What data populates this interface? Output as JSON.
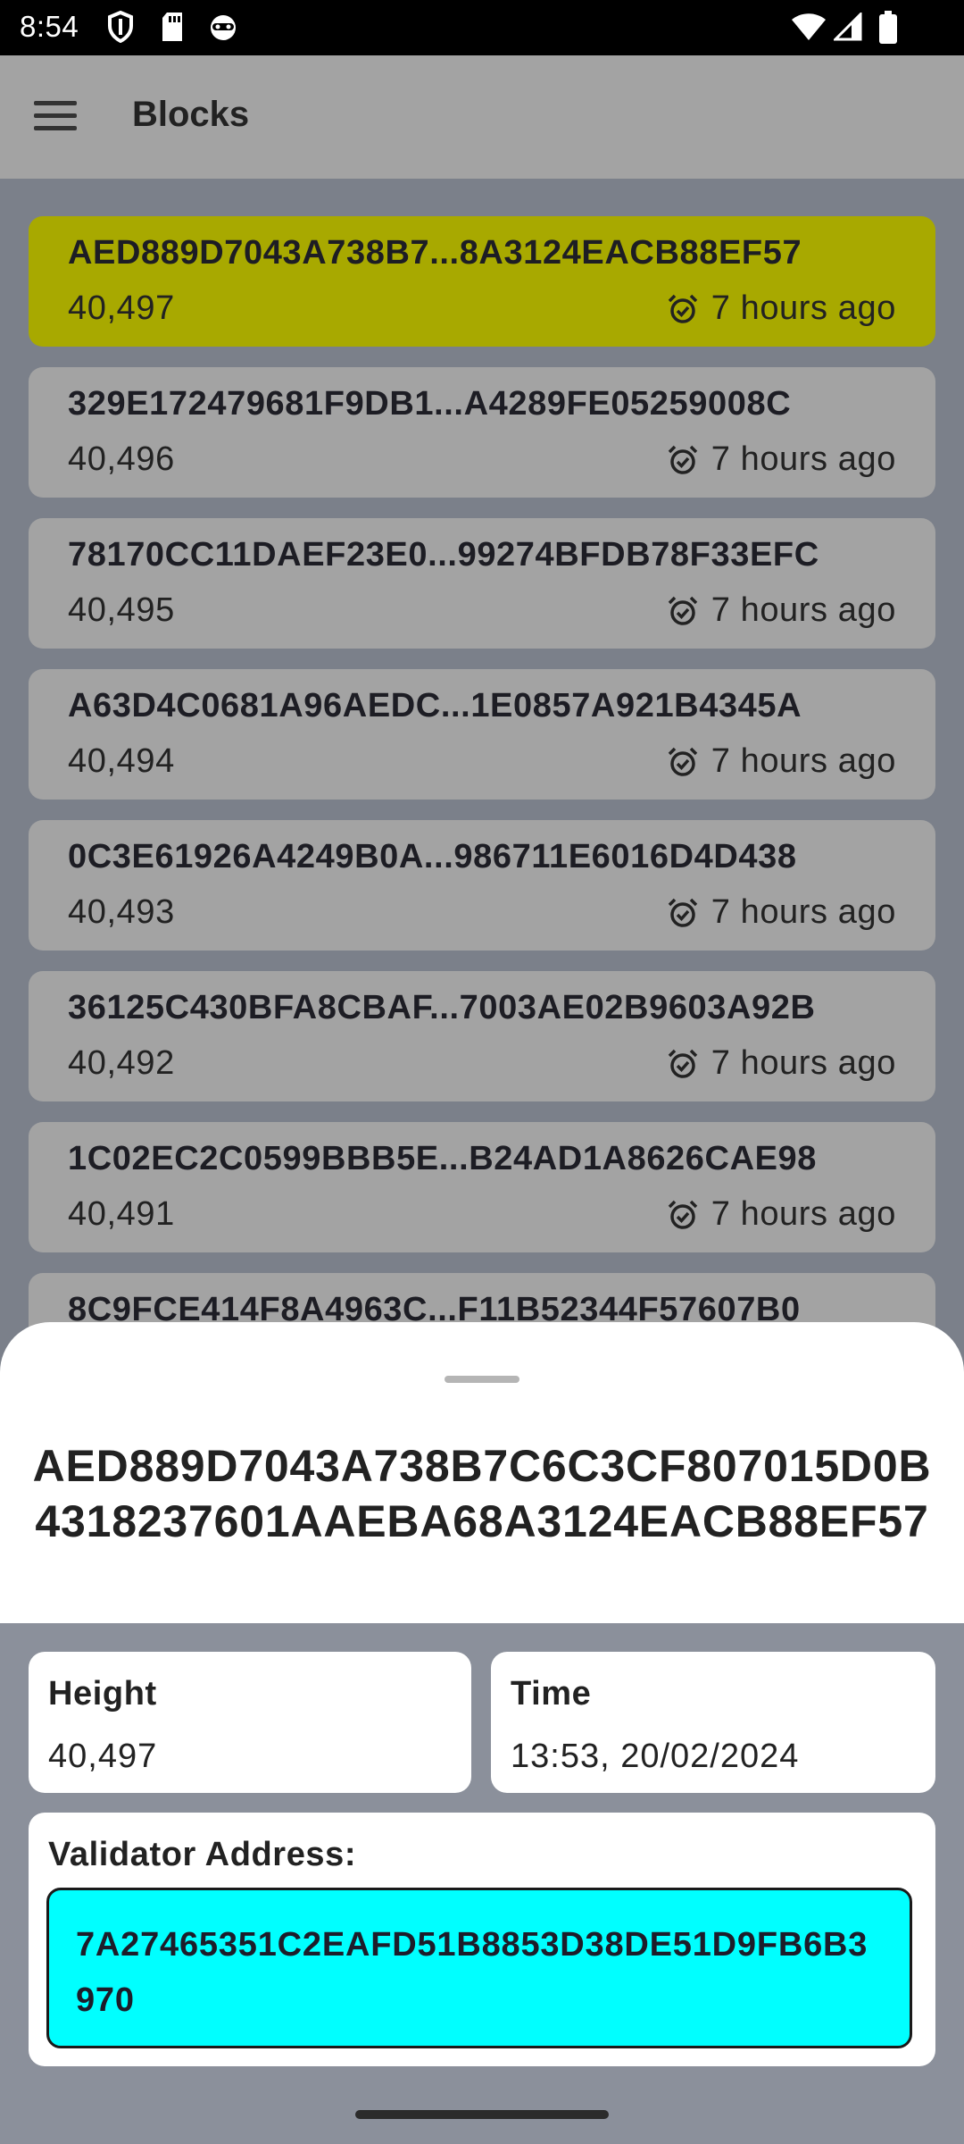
{
  "status_bar": {
    "time": "8:54",
    "left_icons": [
      "shield-icon",
      "sd-card-icon",
      "android-robot-icon"
    ],
    "right_icons": [
      "wifi-icon",
      "cell-signal-icon",
      "battery-icon"
    ]
  },
  "app_bar": {
    "title": "Blocks",
    "menu_icon": "hamburger-menu-icon"
  },
  "blocks": [
    {
      "hash": "AED889D7043A738B7...8A3124EACB88EF57",
      "height": "40,497",
      "time": "7 hours ago",
      "selected": true
    },
    {
      "hash": "329E172479681F9DB1...A4289FE05259008C",
      "height": "40,496",
      "time": "7 hours ago",
      "selected": false
    },
    {
      "hash": "78170CC11DAEF23E0...99274BFDB78F33EFC",
      "height": "40,495",
      "time": "7 hours ago",
      "selected": false
    },
    {
      "hash": "A63D4C0681A96AEDC...1E0857A921B4345A",
      "height": "40,494",
      "time": "7 hours ago",
      "selected": false
    },
    {
      "hash": "0C3E61926A4249B0A...986711E6016D4D438",
      "height": "40,493",
      "time": "7 hours ago",
      "selected": false
    },
    {
      "hash": "36125C430BFA8CBAF...7003AE02B9603A92B",
      "height": "40,492",
      "time": "7 hours ago",
      "selected": false
    },
    {
      "hash": "1C02EC2C0599BBB5E...B24AD1A8626CAE98",
      "height": "40,491",
      "time": "7 hours ago",
      "selected": false
    },
    {
      "hash": "8C9FCE414F8A4963C...F11B52344F57607B0",
      "height": "",
      "time": "",
      "selected": false
    }
  ],
  "sheet": {
    "title": "AED889D7043A738B7C6C3CF807015D0B4318237601AAEBA68A3124EACB88EF57",
    "height_label": "Height",
    "height_value": "40,497",
    "time_label": "Time",
    "time_value": "13:53, 20/02/2024",
    "validator_label": "Validator Address:",
    "validator_value": "7A27465351C2EAFD51B8853D38DE51D9FB6B3970"
  },
  "colors": {
    "selected_card": "#a8a900",
    "card": "#a3a3a3",
    "validator_highlight": "#00ffff"
  }
}
